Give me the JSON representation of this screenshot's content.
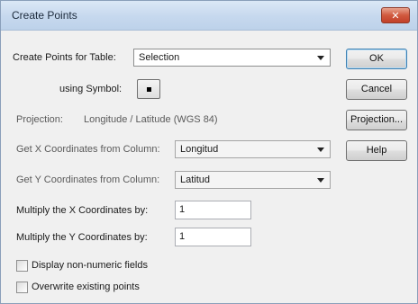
{
  "window": {
    "title": "Create Points",
    "close_glyph": "✕"
  },
  "form": {
    "table_label": "Create Points for Table:",
    "table_value": "Selection",
    "symbol_label": "using Symbol:",
    "projection_label": "Projection:",
    "projection_value": "Longitude / Latitude (WGS 84)",
    "x_column_label": "Get X Coordinates from Column:",
    "x_column_value": "Longitud",
    "y_column_label": "Get Y Coordinates from Column:",
    "y_column_value": "Latitud",
    "x_multiply_label": "Multiply the X Coordinates by:",
    "x_multiply_value": "1",
    "y_multiply_label": "Multiply the Y Coordinates by:",
    "y_multiply_value": "1",
    "display_nonnumeric_label": "Display non-numeric fields",
    "overwrite_label": "Overwrite existing points"
  },
  "buttons": {
    "ok": "OK",
    "cancel": "Cancel",
    "projection": "Projection...",
    "help": "Help"
  },
  "icons": {
    "close": "close-icon",
    "dropdown": "chevron-down-icon",
    "symbol": "square-symbol-icon"
  }
}
